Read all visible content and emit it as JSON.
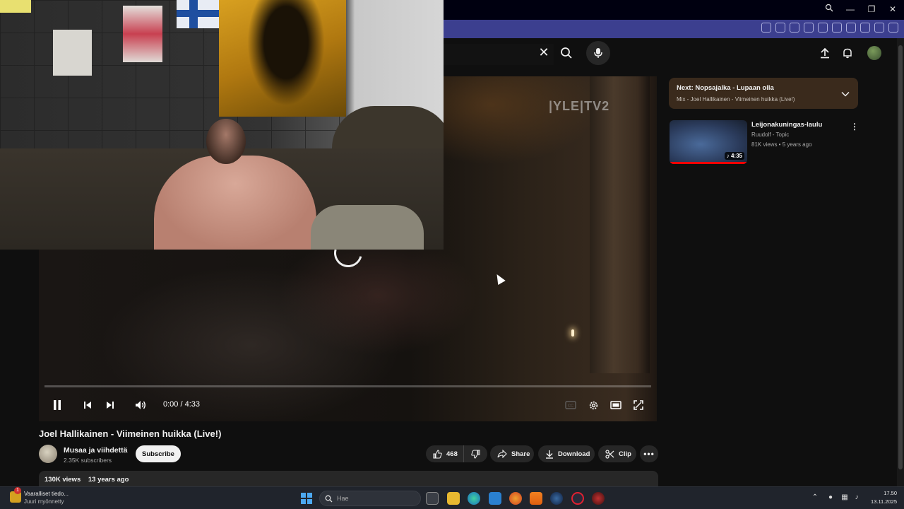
{
  "browser": {
    "window_controls": [
      "search",
      "minimize",
      "maximize",
      "close"
    ]
  },
  "youtube_header": {
    "search_clear_icon": "close-icon",
    "search_icon": "search-icon",
    "mic_icon": "mic-icon",
    "upload_icon": "upload-icon",
    "bell_icon": "bell-icon"
  },
  "player": {
    "watermark": "|YLE|TV2",
    "time_display": "0:00 / 4:33",
    "progress_fraction": 0.0,
    "state": "loading"
  },
  "video": {
    "title": "Joel Hallikainen - Viimeinen huikka (Live!)",
    "channel_name": "Musaa ja viihdettä",
    "subscribers": "2.35K subscribers",
    "subscribe_label": "Subscribe",
    "like_count": "468",
    "share_label": "Share",
    "download_label": "Download",
    "clip_label": "Clip",
    "views": "130K views",
    "uploaded": "13 years ago"
  },
  "sidebar": {
    "next_title": "Next: Nopsajalka - Lupaan olla",
    "next_subtitle": "Mix - Joel Hallikainen - Viimeinen huikka (Live!)",
    "items": [
      {
        "title": "Leijonakuningas-laulu",
        "channel": "Ruudolf - Topic",
        "meta": "81K views • 5 years ago",
        "duration": "4:35"
      }
    ]
  },
  "taskbar": {
    "notification_title": "Vaaralliset tiedo...",
    "notification_sub": "Juuri myönnetty",
    "notification_badge": "1",
    "search_placeholder": "Hae",
    "time": "17.50",
    "date": "13.11.2025"
  }
}
